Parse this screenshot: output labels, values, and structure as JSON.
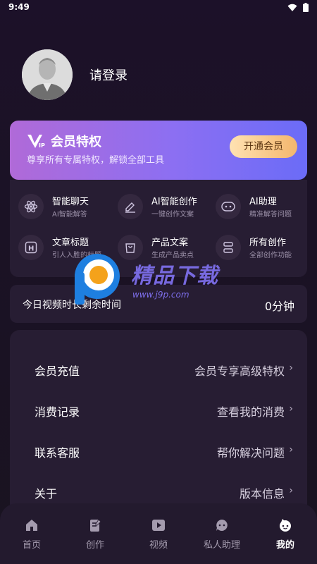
{
  "status_bar": {
    "time": "9:49"
  },
  "profile": {
    "login_text": "请登录"
  },
  "vip_card": {
    "title": "会员特权",
    "subtitle": "尊享所有专属特权，解锁全部工具",
    "button_label": "开通会员"
  },
  "features": [
    {
      "title": "智能聊天",
      "subtitle": "AI智能解答",
      "icon": "atom-icon"
    },
    {
      "title": "AI智能创作",
      "subtitle": "一键创作文案",
      "icon": "edit-pen-icon"
    },
    {
      "title": "AI助理",
      "subtitle": "精准解答问题",
      "icon": "robot-face-icon"
    },
    {
      "title": "文章标题",
      "subtitle": "引人入胜的标题",
      "icon": "heading-icon"
    },
    {
      "title": "产品文案",
      "subtitle": "生成产品卖点",
      "icon": "shopping-bag-icon"
    },
    {
      "title": "所有创作",
      "subtitle": "全部创作功能",
      "icon": "layers-icon"
    }
  ],
  "video_time": {
    "label": "今日视频时长剩余时间",
    "value": "0分钟"
  },
  "menu": [
    {
      "key": "会员充值",
      "value": "会员专享高级特权"
    },
    {
      "key": "消费记录",
      "value": "查看我的消费"
    },
    {
      "key": "联系客服",
      "value": "帮你解决问题"
    },
    {
      "key": "关于",
      "value": "版本信息"
    }
  ],
  "watermark": {
    "text": "精品下载",
    "url": "www.j9p.com"
  },
  "tabbar": [
    {
      "label": "首页",
      "icon": "home-icon",
      "active": false
    },
    {
      "label": "创作",
      "icon": "document-edit-icon",
      "active": false
    },
    {
      "label": "视频",
      "icon": "play-icon",
      "active": false
    },
    {
      "label": "私人助理",
      "icon": "chat-bubble-icon",
      "active": false
    },
    {
      "label": "我的",
      "icon": "face-icon",
      "active": true
    }
  ],
  "colors": {
    "background": "#1c1129",
    "card": "#271d33",
    "vip_gradient_start": "#b06ad8",
    "vip_gradient_end": "#6b6cf7",
    "button_gold": "#f4b66d"
  }
}
